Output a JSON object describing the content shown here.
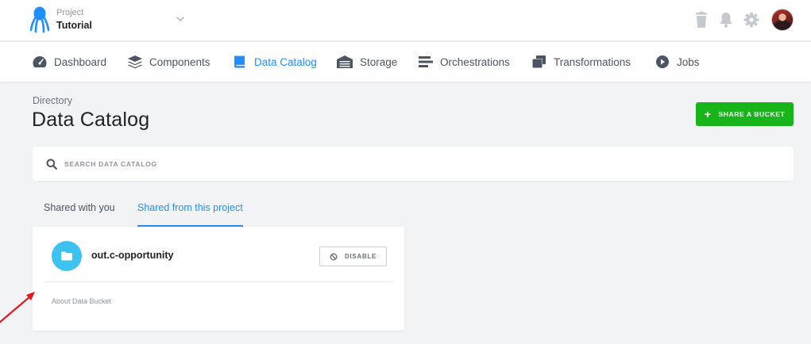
{
  "header": {
    "project_label": "Project",
    "project_name": "Tutorial"
  },
  "nav": {
    "items": [
      {
        "label": "Dashboard",
        "icon": "dashboard-icon"
      },
      {
        "label": "Components",
        "icon": "components-icon"
      },
      {
        "label": "Data Catalog",
        "icon": "book-icon",
        "active": true
      },
      {
        "label": "Storage",
        "icon": "storage-icon"
      },
      {
        "label": "Orchestrations",
        "icon": "orchestrations-icon"
      },
      {
        "label": "Transformations",
        "icon": "transformations-icon"
      },
      {
        "label": "Jobs",
        "icon": "play-circle-icon"
      }
    ]
  },
  "page": {
    "directory_label": "Directory",
    "title": "Data Catalog",
    "share_button": "SHARE A BUCKET"
  },
  "search": {
    "placeholder": "SEARCH DATA CATALOG"
  },
  "tabs": [
    {
      "label": "Shared with you",
      "active": false
    },
    {
      "label": "Shared from this project",
      "active": true
    }
  ],
  "bucket": {
    "name": "out.c-opportunity",
    "disable_label": "DISABLE",
    "about": "About Data Bucket"
  },
  "colors": {
    "accent": "#1f8fff",
    "success": "#18b51a",
    "folder": "#3dc3ef",
    "annotation_arrow": "#e3161b"
  }
}
